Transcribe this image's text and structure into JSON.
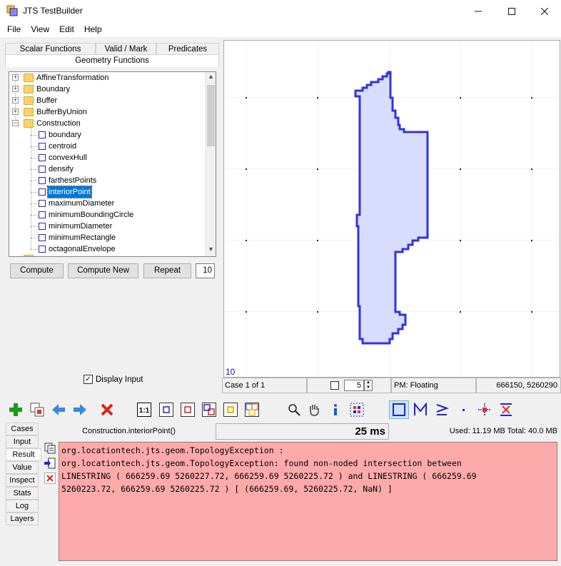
{
  "window": {
    "title": "JTS TestBuilder",
    "minimize": "—",
    "maximize": "☐",
    "close": "✕"
  },
  "menu": [
    "File",
    "View",
    "Edit",
    "Help"
  ],
  "tabs": {
    "scalar": "Scalar Functions",
    "valid": "Valid / Mark",
    "predicates": "Predicates",
    "geometry": "Geometry Functions"
  },
  "tree": {
    "folders": [
      "AffineTransformation",
      "Boundary",
      "Buffer",
      "BufferByUnion",
      "Construction"
    ],
    "construction_items": [
      "boundary",
      "centroid",
      "convexHull",
      "densify",
      "farthestPoints",
      "interiorPoint",
      "maximumDiameter",
      "minimumBoundingCircle",
      "minimumDiameter",
      "minimumRectangle",
      "octagonalEnvelope"
    ],
    "selected": "interiorPoint"
  },
  "buttons": {
    "compute": "Compute",
    "compute_new": "Compute New",
    "repeat": "Repeat",
    "repeat_count": "10"
  },
  "display_input": {
    "label": "Display Input",
    "checked": true
  },
  "map": {
    "scale_label": "10",
    "fill_color": "#d8dcff",
    "stroke_color": "#3333dd"
  },
  "status": {
    "case": "Case 1 of 1",
    "precision_value": "5",
    "pm": "PM: Floating",
    "coords": "666150, 5260290"
  },
  "toolbar_icons": [
    "add-icon",
    "copy-case-icon",
    "prev-icon",
    "next-icon",
    "delete-icon",
    "zoom-1-1-icon",
    "extent-a-icon",
    "extent-b-icon",
    "extent-ab-icon",
    "extent-result-icon",
    "extent-all-icon",
    "zoom-icon",
    "pan-icon",
    "info-icon",
    "extract-icon",
    "draw-polygon-icon",
    "draw-linestring-icon",
    "draw-multiline-icon",
    "draw-point-icon",
    "edit-vertex-icon",
    "delete-vertex-icon"
  ],
  "side_tabs": [
    "Cases",
    "Input",
    "Result",
    "Value",
    "Inspect",
    "Stats",
    "Log",
    "Layers"
  ],
  "active_side_tab": "Result",
  "result": {
    "function": "Construction.interiorPoint()",
    "time": "25 ms",
    "memory": "Used: 11.19 MB   Total: 40.0 MB",
    "error_lines": [
      "org.locationtech.jts.geom.TopologyException :",
      "org.locationtech.jts.geom.TopologyException: found non-noded intersection between",
      "LINESTRING ( 666259.69 5260227.72, 666259.69 5260225.72 ) and LINESTRING ( 666259.69",
      "5260223.72, 666259.69 5260225.72 ) [ (666259.69, 5260225.72, NaN) ]"
    ]
  }
}
